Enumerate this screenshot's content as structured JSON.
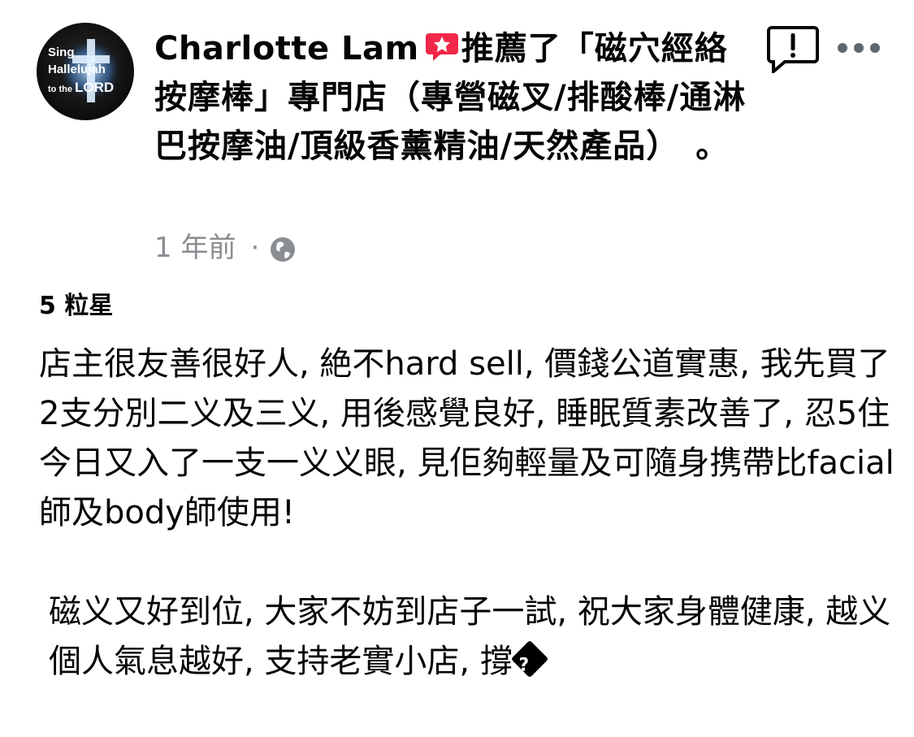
{
  "avatar": {
    "line1": "Sing",
    "line2": "Hallelujah",
    "line3_prefix": "to the",
    "line3_bold": "LORD"
  },
  "header": {
    "author": "Charlotte Lam",
    "action": "推薦了「磁穴經絡按摩棒」專門店（專營磁叉/排酸棒/通淋巴按摩油/頂級香薰精油/天然產品）",
    "end_mark": "。"
  },
  "meta": {
    "time": "1 年前",
    "separator": "·",
    "privacy_icon": "globe-icon"
  },
  "rating": "5 粒星",
  "review": {
    "paragraph1": "店主很友善很好人, 絶不hard sell, 價錢公道實惠, 我先買了2支分別二义及三义, 用後感覺良好, 睡眠質素改善了, 忍5住今日又入了一支一义义眼, 見佢夠輕量及可隨身携帶比facial師及body師使用!",
    "paragraph2": "磁义又好到位, 大家不妨到店子一試, 祝大家身體健康, 越义個人氣息越好, 支持老實小店, 撐",
    "trailing_glyph": "?"
  },
  "icons": {
    "recommend": "recommend-speech-bubble-icon",
    "report": "report-exclamation-icon",
    "more": "more-dots-icon"
  },
  "colors": {
    "recommend_red": "#f02849",
    "meta_gray": "#8a8d91",
    "text": "#050505"
  }
}
